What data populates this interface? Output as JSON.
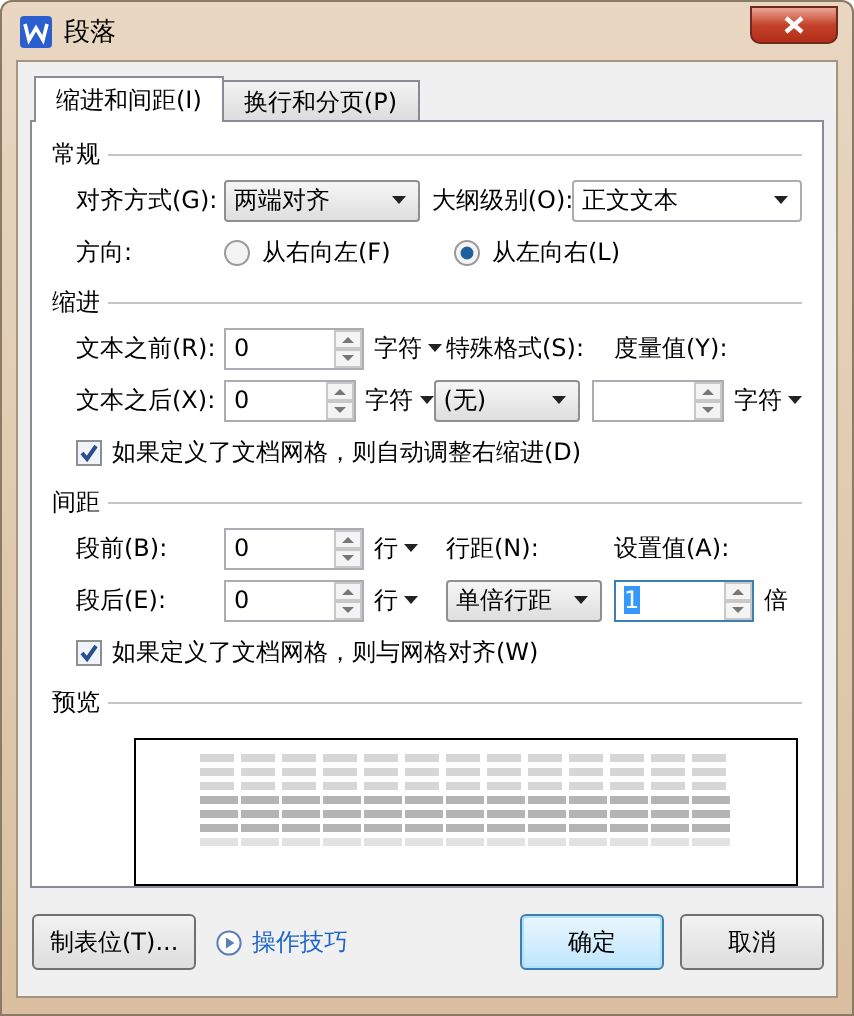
{
  "window": {
    "title": "段落"
  },
  "tabs": [
    {
      "label": "缩进和间距(I)",
      "selected": true
    },
    {
      "label": "换行和分页(P)",
      "selected": false
    }
  ],
  "general": {
    "title": "常规",
    "alignment": {
      "label": "对齐方式(G):",
      "value": "两端对齐"
    },
    "outline_level": {
      "label": "大纲级别(O):",
      "value": "正文文本"
    },
    "direction": {
      "label": "方向:",
      "options": [
        {
          "label": "从右向左(F)",
          "selected": false
        },
        {
          "label": "从左向右(L)",
          "selected": true
        }
      ]
    }
  },
  "indent": {
    "title": "缩进",
    "before": {
      "label": "文本之前(R):",
      "value": "0",
      "unit": "字符"
    },
    "after": {
      "label": "文本之后(X):",
      "value": "0",
      "unit": "字符"
    },
    "special": {
      "label": "特殊格式(S):",
      "value": "(无)"
    },
    "measure": {
      "label": "度量值(Y):",
      "unit": "字符"
    },
    "auto_adjust": {
      "label": "如果定义了文档网格，则自动调整右缩进(D)",
      "checked": true
    }
  },
  "spacing": {
    "title": "间距",
    "before": {
      "label": "段前(B):",
      "value": "0",
      "unit": "行"
    },
    "after": {
      "label": "段后(E):",
      "value": "0",
      "unit": "行"
    },
    "line_spacing": {
      "label": "行距(N):",
      "value": "单倍行距"
    },
    "setting": {
      "label": "设置值(A):",
      "value": "1",
      "unit": "倍",
      "focused": true
    },
    "snap_to_grid": {
      "label": "如果定义了文档网格，则与网格对齐(W)",
      "checked": true
    }
  },
  "preview": {
    "title": "预览"
  },
  "footer": {
    "tabs_button": "制表位(T)...",
    "tips_link": "操作技巧",
    "ok_button": {
      "label": "确定",
      "default": true
    },
    "cancel_button": {
      "label": "取消",
      "default": false
    }
  }
}
